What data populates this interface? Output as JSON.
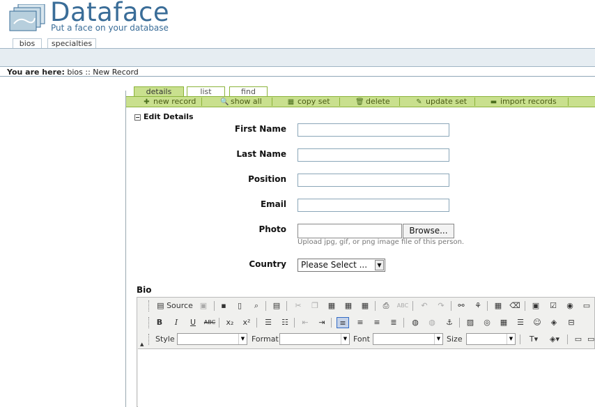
{
  "logo": {
    "title": "Dataface",
    "tagline": "Put a face on your database",
    "mini_text": "dataface"
  },
  "table_tabs": [
    {
      "label": "bios"
    },
    {
      "label": "specialties"
    }
  ],
  "breadcrumb": {
    "prefix": "You are here:",
    "path": "bios :: New Record"
  },
  "record_tabs": [
    {
      "label": "details"
    },
    {
      "label": "list"
    },
    {
      "label": "find"
    }
  ],
  "actions": [
    {
      "label": "new record",
      "icon": "plus-icon"
    },
    {
      "label": "show all",
      "icon": "magnifier-icon"
    },
    {
      "label": "copy set",
      "icon": "grid-icon"
    },
    {
      "label": "delete",
      "icon": "trash-icon"
    },
    {
      "label": "update set",
      "icon": "pencil-icon"
    },
    {
      "label": "import records",
      "icon": "printer-icon"
    }
  ],
  "section": {
    "title": "Edit Details",
    "toggle": "−"
  },
  "fields": {
    "first_name": {
      "label": "First Name",
      "value": ""
    },
    "last_name": {
      "label": "Last Name",
      "value": ""
    },
    "position": {
      "label": "Position",
      "value": ""
    },
    "email": {
      "label": "Email",
      "value": ""
    },
    "photo": {
      "label": "Photo",
      "browse": "Browse...",
      "help": "Upload jpg, gif, or png image file of this person."
    },
    "country": {
      "label": "Country",
      "selected": "Please Select ..."
    }
  },
  "bio": {
    "label": "Bio",
    "toolbar": {
      "source": "Source",
      "style": "Style",
      "format": "Format",
      "font": "Font",
      "size": "Size",
      "abc": "ABC"
    }
  },
  "colors": {
    "brand": "#3a6d98",
    "action_bar": "#c9e08e",
    "table_bar": "#e6edf2"
  }
}
